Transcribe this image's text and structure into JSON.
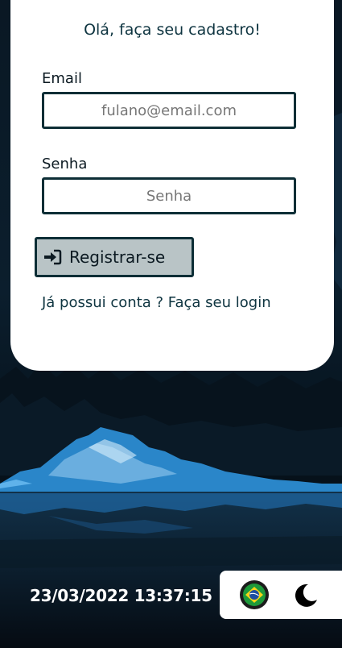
{
  "form": {
    "title": "Olá, faça seu cadastro!",
    "email_label": "Email",
    "email_placeholder": "fulano@email.com",
    "email_value": "",
    "password_label": "Senha",
    "password_placeholder": "Senha",
    "password_value": "",
    "register_label": "Registrar-se",
    "register_icon": "sign-in-icon",
    "login_link": "Já possui conta ? Faça seu login"
  },
  "footer": {
    "datetime": "23/03/2022 13:37:15",
    "language_icon": "brazil-flag-icon",
    "theme_icon": "moon-icon"
  },
  "colors": {
    "primary_dark": "#0d2e36",
    "button_bg": "#b9c4c6",
    "card_bg": "#ffffff",
    "water_blue": "#2e8fd6"
  }
}
